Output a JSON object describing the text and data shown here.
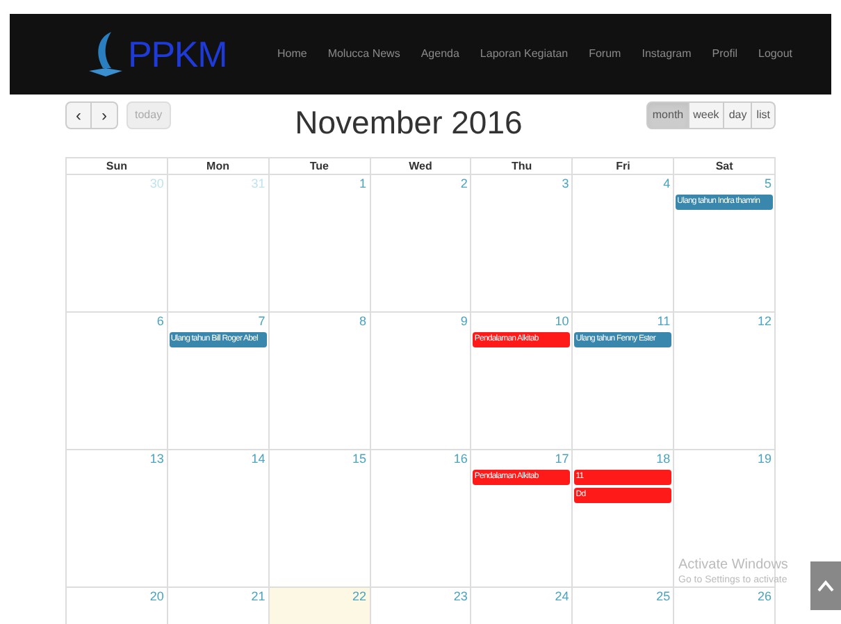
{
  "navbar": {
    "logo": "PPKM",
    "items": [
      {
        "label": "Home"
      },
      {
        "label": "Molucca News"
      },
      {
        "label": "Agenda"
      },
      {
        "label": "Laporan Kegiatan"
      },
      {
        "label": "Forum"
      },
      {
        "label": "Instagram"
      },
      {
        "label": "Profil"
      },
      {
        "label": "Logout"
      }
    ]
  },
  "toolbar": {
    "prev": "‹",
    "next": "›",
    "today": "today",
    "title": "November 2016",
    "views": [
      {
        "label": "month",
        "selected": true
      },
      {
        "label": "week",
        "selected": false
      },
      {
        "label": "day",
        "selected": false
      },
      {
        "label": "list",
        "selected": false
      }
    ]
  },
  "calendar": {
    "weekdays": [
      "Sun",
      "Mon",
      "Tue",
      "Wed",
      "Thu",
      "Fri",
      "Sat"
    ],
    "weeks": [
      {
        "days": [
          {
            "number": "30",
            "other_month": true,
            "today": false
          },
          {
            "number": "31",
            "other_month": true,
            "today": false
          },
          {
            "number": "1",
            "other_month": false,
            "today": false
          },
          {
            "number": "2",
            "other_month": false,
            "today": false
          },
          {
            "number": "3",
            "other_month": false,
            "today": false
          },
          {
            "number": "4",
            "other_month": false,
            "today": false
          },
          {
            "number": "5",
            "other_month": false,
            "today": false,
            "events": [
              {
                "title": "Ulang tahun Indra thamrin",
                "color": "#3a87ad"
              }
            ]
          }
        ]
      },
      {
        "days": [
          {
            "number": "6",
            "other_month": false,
            "today": false
          },
          {
            "number": "7",
            "other_month": false,
            "today": false,
            "events": [
              {
                "title": "Ulang tahun Bill Roger Abel",
                "color": "#3a87ad"
              }
            ]
          },
          {
            "number": "8",
            "other_month": false,
            "today": false
          },
          {
            "number": "9",
            "other_month": false,
            "today": false
          },
          {
            "number": "10",
            "other_month": false,
            "today": false,
            "events": [
              {
                "title": "Pendalaman Alkitab",
                "color": "#ff1a1a"
              }
            ]
          },
          {
            "number": "11",
            "other_month": false,
            "today": false,
            "events": [
              {
                "title": "Ulang tahun Fenny Ester",
                "color": "#3a87ad"
              }
            ]
          },
          {
            "number": "12",
            "other_month": false,
            "today": false
          }
        ]
      },
      {
        "days": [
          {
            "number": "13",
            "other_month": false,
            "today": false
          },
          {
            "number": "14",
            "other_month": false,
            "today": false
          },
          {
            "number": "15",
            "other_month": false,
            "today": false
          },
          {
            "number": "16",
            "other_month": false,
            "today": false
          },
          {
            "number": "17",
            "other_month": false,
            "today": false,
            "events": [
              {
                "title": "Pendalaman Alkitab",
                "color": "#ff1a1a"
              }
            ]
          },
          {
            "number": "18",
            "other_month": false,
            "today": false,
            "events": [
              {
                "title": "11",
                "color": "#ff1a1a"
              },
              {
                "title": "Dd",
                "color": "#ff1a1a"
              }
            ]
          },
          {
            "number": "19",
            "other_month": false,
            "today": false
          }
        ]
      },
      {
        "days": [
          {
            "number": "20",
            "other_month": false,
            "today": false
          },
          {
            "number": "21",
            "other_month": false,
            "today": false
          },
          {
            "number": "22",
            "other_month": false,
            "today": true
          },
          {
            "number": "23",
            "other_month": false,
            "today": false
          },
          {
            "number": "24",
            "other_month": false,
            "today": false
          },
          {
            "number": "25",
            "other_month": false,
            "today": false
          },
          {
            "number": "26",
            "other_month": false,
            "today": false
          }
        ]
      }
    ]
  },
  "os_notice": {
    "title": "Activate Windows",
    "text": "Go to Settings to activate"
  }
}
